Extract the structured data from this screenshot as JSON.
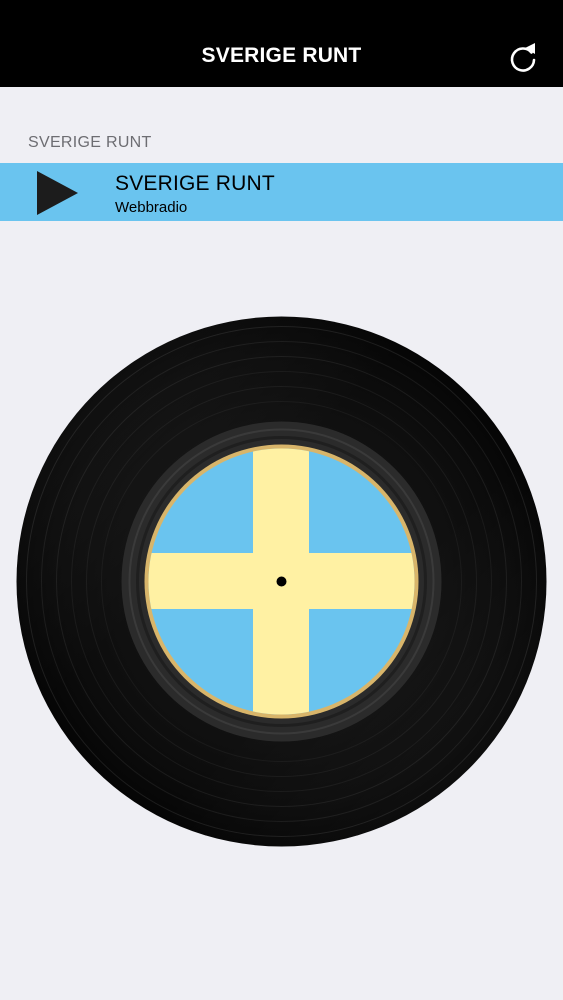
{
  "navbar": {
    "title": "SVERIGE RUNT",
    "refresh_icon": "refresh-icon"
  },
  "list": {
    "section_header": "SVERIGE RUNT",
    "items": [
      {
        "title": "SVERIGE RUNT",
        "subtitle": "Webbradio",
        "icon": "play-icon",
        "selected": true
      }
    ]
  },
  "record": {
    "icon": "vinyl-record-icon",
    "label_icon": "swedish-flag-label-icon"
  },
  "colors": {
    "navbar_bg": "#000000",
    "page_bg": "#efeff4",
    "selected_row": "#6ac4ef",
    "flag_blue": "#6ac4ef",
    "flag_yellow": "#fff1a3",
    "vinyl": "#0e0e0e"
  }
}
